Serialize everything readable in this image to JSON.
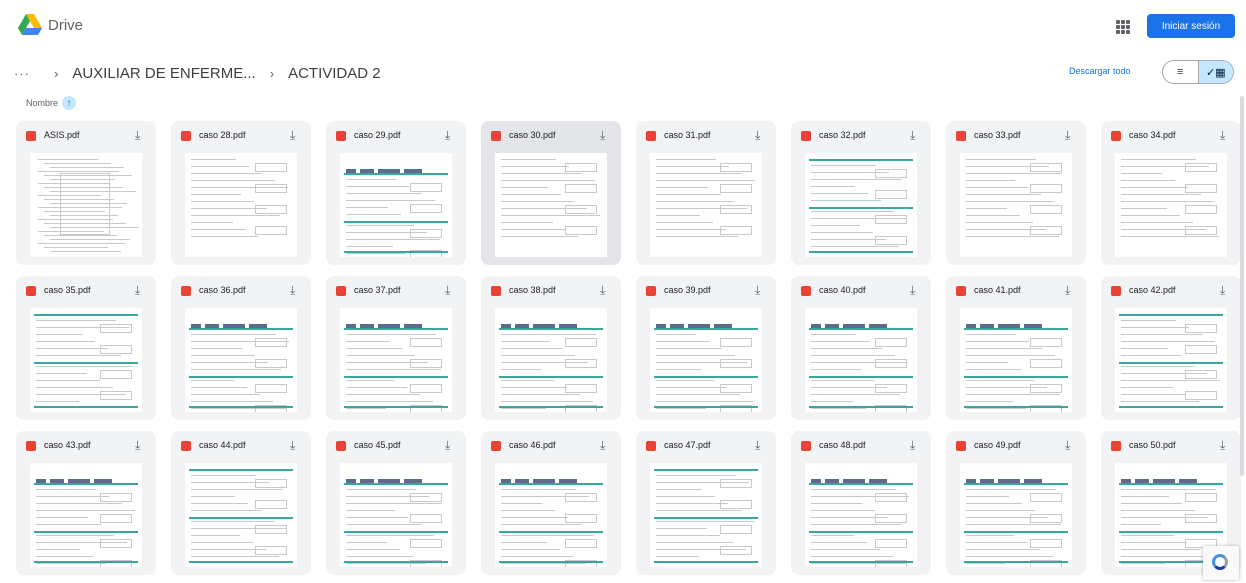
{
  "header": {
    "brand": "Drive",
    "signin_label": "Iniciar sesión"
  },
  "breadcrumb": {
    "more": "···",
    "items": [
      "AUXILIAR DE ENFERME...",
      "ACTIVIDAD 2"
    ]
  },
  "toolbar": {
    "download_all": "Descargar todo",
    "view_list_icon": "≡",
    "view_grid_icon": "✓▦"
  },
  "sort": {
    "label": "Nombre",
    "arrow": "↑"
  },
  "files": [
    {
      "name": "ASIS.pdf",
      "style": "dense"
    },
    {
      "name": "caso 28.pdf",
      "style": "form"
    },
    {
      "name": "caso 29.pdf",
      "style": "logo"
    },
    {
      "name": "caso 30.pdf",
      "style": "form"
    },
    {
      "name": "caso 31.pdf",
      "style": "form"
    },
    {
      "name": "caso 32.pdf",
      "style": "teal"
    },
    {
      "name": "caso 33.pdf",
      "style": "form"
    },
    {
      "name": "caso 34.pdf",
      "style": "form"
    },
    {
      "name": "caso 35.pdf",
      "style": "teal"
    },
    {
      "name": "caso 36.pdf",
      "style": "logo"
    },
    {
      "name": "caso 37.pdf",
      "style": "logo"
    },
    {
      "name": "caso 38.pdf",
      "style": "logo"
    },
    {
      "name": "caso 39.pdf",
      "style": "logo"
    },
    {
      "name": "caso 40.pdf",
      "style": "logo"
    },
    {
      "name": "caso 41.pdf",
      "style": "logo"
    },
    {
      "name": "caso 42.pdf",
      "style": "teal"
    },
    {
      "name": "caso 43.pdf",
      "style": "logo"
    },
    {
      "name": "caso 44.pdf",
      "style": "teal"
    },
    {
      "name": "caso 45.pdf",
      "style": "logo"
    },
    {
      "name": "caso 46.pdf",
      "style": "logo"
    },
    {
      "name": "caso 47.pdf",
      "style": "teal"
    },
    {
      "name": "caso 48.pdf",
      "style": "logo"
    },
    {
      "name": "caso 49.pdf",
      "style": "logo"
    },
    {
      "name": "caso 50.pdf",
      "style": "logo"
    }
  ],
  "icons": {
    "file_type": "pdf-icon",
    "download": "download-icon",
    "apps": "apps-grid-icon"
  },
  "colors": {
    "accent": "#1a73e8",
    "pdf": "#ea4335",
    "selected_toggle": "#c2e7ff",
    "form_teal": "#3aa79d"
  }
}
